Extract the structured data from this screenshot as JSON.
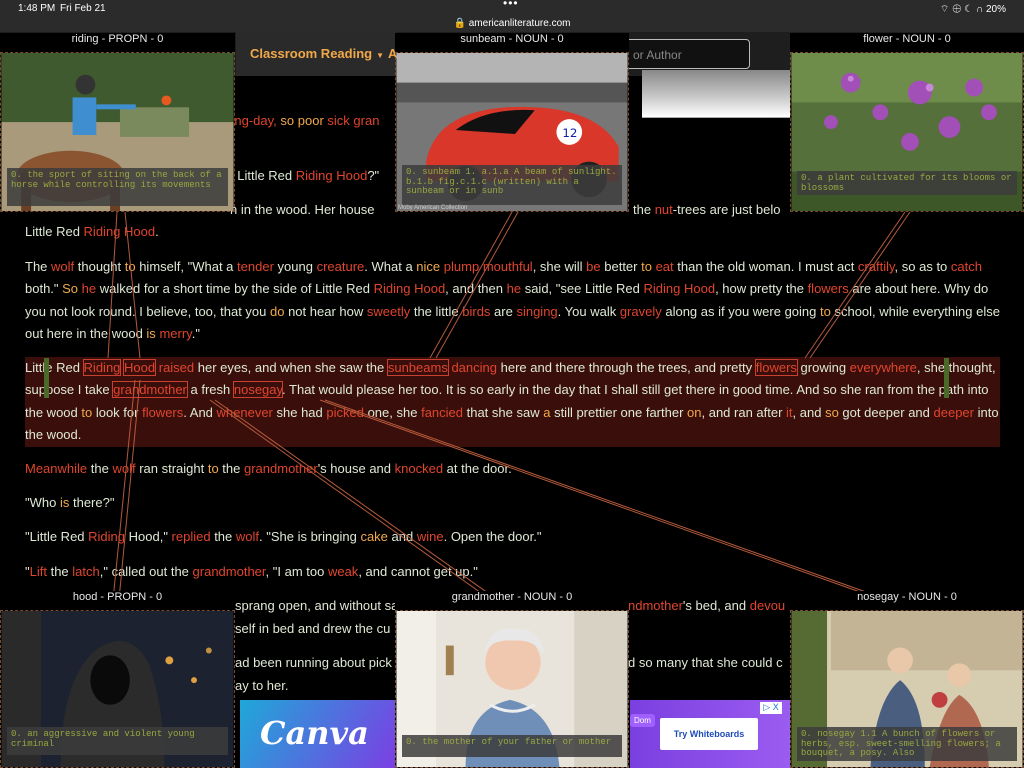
{
  "status": {
    "time": "1:48 PM",
    "date": "Fri Feb 21",
    "indicators": "⌔ ⊕ ☾ ∩ 20%",
    "url": "americanliterature.com"
  },
  "nav": {
    "menu_label": "Classroom Reading",
    "next_label": "A",
    "search_placeholder": "or Author"
  },
  "story": {
    "p1_frag_a": "king-day,",
    "p1_frag_b": "so poor",
    "p1_frag_c": "sick gran",
    "p2_frag": ", Little Red",
    "p2_riding": "Riding Hood",
    "p2_end": "?\"",
    "p3_a": "n in the wood. Her house",
    "p3_b": "the",
    "p3_c": "nut",
    "p3_d": "-trees are just belo",
    "p3_line2_a": "Little Red",
    "p3_line2_b": "Riding Hood",
    "p3_line2_c": ".",
    "p4": [
      [
        "The ",
        "w"
      ],
      [
        "wolf",
        "r"
      ],
      [
        " thought ",
        "w"
      ],
      [
        "to",
        "o"
      ],
      [
        " himself, \"What a ",
        "w"
      ],
      [
        "tender",
        "r"
      ],
      [
        " young ",
        "w"
      ],
      [
        "creature",
        "r"
      ],
      [
        ". What a ",
        "w"
      ],
      [
        "nice",
        "o"
      ],
      [
        " ",
        "w"
      ],
      [
        "plump",
        "r"
      ],
      [
        " ",
        "w"
      ],
      [
        "mouthful",
        "r"
      ],
      [
        ", she will ",
        "w"
      ],
      [
        "be",
        "r"
      ],
      [
        " better ",
        "w"
      ],
      [
        "to",
        "o"
      ],
      [
        " ",
        "w"
      ],
      [
        "eat",
        "r"
      ],
      [
        " than the old woman. I must act ",
        "w"
      ],
      [
        "craftily",
        "r"
      ],
      [
        ", so as to ",
        "w"
      ],
      [
        "catch",
        "r"
      ],
      [
        " both.\" ",
        "w"
      ],
      [
        "So",
        "o"
      ],
      [
        " ",
        "w"
      ],
      [
        "he",
        "r"
      ],
      [
        " walked for a short time by the side of Little Red ",
        "w"
      ],
      [
        "Riding",
        "r"
      ],
      [
        " ",
        "w"
      ],
      [
        "Hood",
        "r"
      ],
      [
        ", and then ",
        "w"
      ],
      [
        "he",
        "r"
      ],
      [
        " said, \"see Little Red ",
        "w"
      ],
      [
        "Riding",
        "r"
      ],
      [
        " ",
        "w"
      ],
      [
        "Hood",
        "r"
      ],
      [
        ", how pretty the ",
        "w"
      ],
      [
        "flowers",
        "r"
      ],
      [
        " are about here. Why do you not look round. I believe, too, that you ",
        "w"
      ],
      [
        "do",
        "o"
      ],
      [
        " not hear how ",
        "w"
      ],
      [
        "sweetly",
        "r"
      ],
      [
        " the little ",
        "w"
      ],
      [
        "birds",
        "r"
      ],
      [
        " are ",
        "w"
      ],
      [
        "singing",
        "r"
      ],
      [
        ". You walk ",
        "w"
      ],
      [
        "gravely",
        "r"
      ],
      [
        " along as if you were going ",
        "w"
      ],
      [
        "to",
        "o"
      ],
      [
        " school, while everything else out here in the wood ",
        "w"
      ],
      [
        "is",
        "o"
      ],
      [
        " ",
        "w"
      ],
      [
        "merry",
        "r"
      ],
      [
        ".\"",
        "w"
      ]
    ],
    "p5": [
      [
        "Little Red ",
        "w"
      ],
      [
        "Riding",
        "rb"
      ],
      [
        " ",
        "w"
      ],
      [
        "Hood",
        "rb"
      ],
      [
        " ",
        "w"
      ],
      [
        "raised",
        "r"
      ],
      [
        " her eyes, and when she saw the ",
        "w"
      ],
      [
        "sunbeams",
        "rb"
      ],
      [
        " ",
        "w"
      ],
      [
        "dancing",
        "r"
      ],
      [
        " here and there through the trees, and pretty ",
        "w"
      ],
      [
        "flowers",
        "rb"
      ],
      [
        " growing ",
        "w"
      ],
      [
        "everywhere",
        "r"
      ],
      [
        ", she thought, suppose I take ",
        "w"
      ],
      [
        "grandmother",
        "rb"
      ],
      [
        " a fresh ",
        "w"
      ],
      [
        "nosegay",
        "rb"
      ],
      [
        ". That would please her too. It is so early in the day that I shall still get there in good time. And so she ran from the path into the wood ",
        "w"
      ],
      [
        "to",
        "o"
      ],
      [
        " look for ",
        "w"
      ],
      [
        "flowers",
        "r"
      ],
      [
        ". And ",
        "w"
      ],
      [
        "whenever",
        "r"
      ],
      [
        " she had ",
        "w"
      ],
      [
        "picked",
        "r"
      ],
      [
        " one, she ",
        "w"
      ],
      [
        "fancied",
        "r"
      ],
      [
        " that she saw ",
        "w"
      ],
      [
        "a",
        "o"
      ],
      [
        " still prettier one farther ",
        "w"
      ],
      [
        "on",
        "o"
      ],
      [
        ", and ran after ",
        "w"
      ],
      [
        "it",
        "r"
      ],
      [
        ", and ",
        "w"
      ],
      [
        "so",
        "o"
      ],
      [
        " got deeper and ",
        "w"
      ],
      [
        "deeper",
        "r"
      ],
      [
        " into the wood.",
        "w"
      ]
    ],
    "p6": [
      [
        "Meanwhile",
        "r"
      ],
      [
        " the ",
        "w"
      ],
      [
        "wolf",
        "r"
      ],
      [
        " ran straight ",
        "w"
      ],
      [
        "to",
        "o"
      ],
      [
        " the ",
        "w"
      ],
      [
        "grandmother",
        "r"
      ],
      [
        "'s house and ",
        "w"
      ],
      [
        "knocked",
        "r"
      ],
      [
        " at the door.",
        "w"
      ]
    ],
    "p7": [
      [
        "\"Who ",
        "w"
      ],
      [
        "is",
        "o"
      ],
      [
        " there?\"",
        "w"
      ]
    ],
    "p8": [
      [
        "\"Little Red ",
        "w"
      ],
      [
        "Riding",
        "r"
      ],
      [
        " Hood,\" ",
        "w"
      ],
      [
        "replied",
        "r"
      ],
      [
        " the ",
        "w"
      ],
      [
        "wolf",
        "r"
      ],
      [
        ". \"She is bringing ",
        "w"
      ],
      [
        "cake",
        "o"
      ],
      [
        " and ",
        "w"
      ],
      [
        "wine",
        "r"
      ],
      [
        ". Open the door.\"",
        "w"
      ]
    ],
    "p9": [
      [
        "\"",
        "w"
      ],
      [
        "Lift",
        "r"
      ],
      [
        " the ",
        "w"
      ],
      [
        "latch",
        "r"
      ],
      [
        ",\" called out the ",
        "w"
      ],
      [
        "grandmother",
        "r"
      ],
      [
        ", \"I am too ",
        "w"
      ],
      [
        "weak",
        "r"
      ],
      [
        ", and cannot get up.\"",
        "w"
      ]
    ],
    "p10_a": "sprang open, and without sa",
    "p10_b": "ndmother",
    "p10_c": "'s bed, and ",
    "p10_d": "devou",
    "p11_a": "self in bed and drew the cu",
    "p12_a": "ad been running about pick",
    "p12_b": "d so many that she could c",
    "p13_a": "ay to her."
  },
  "cards": {
    "riding": {
      "label": "riding - PROPN - 0",
      "gloss": "0. the sport of siting on the back of a horse while controlling its movements"
    },
    "sunbeam": {
      "label": "sunbeam - NOUN - 0",
      "gloss": "0. sunbeam 1. a.1.a A beam of sunlight. b.1.b fig.c.1.c (written) with a sunbeam or in sunb",
      "caption": "Moby American Collection"
    },
    "flower": {
      "label": "flower - NOUN - 0",
      "gloss": "0. a plant cultivated for its blooms or blossoms"
    },
    "hood": {
      "label": "hood - PROPN - 0",
      "gloss": "0. an aggressive and violent young criminal"
    },
    "grandmother": {
      "label": "grandmother - NOUN - 0",
      "gloss": "0. the mother of your father or mother"
    },
    "nosegay": {
      "label": "nosegay - NOUN - 0",
      "gloss": "0. nosegay 1.1 A bunch of flowers or herbs, esp. sweet-smelling flowers; a bouquet, a posy. Also"
    }
  },
  "ads": {
    "canva_text": "Canva",
    "right_button": "Try Whiteboards",
    "right_tag": "Dom",
    "right_close": "▷ X"
  },
  "colors": {
    "accent_red": "#e0452e",
    "accent_orange": "#f0a94a",
    "gloss_text": "#9aa840"
  }
}
